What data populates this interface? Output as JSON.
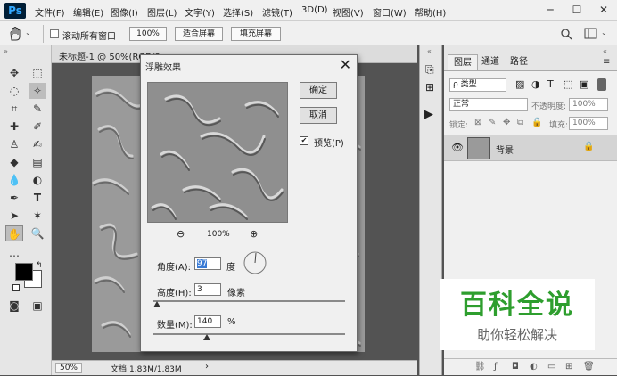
{
  "app": {
    "logo": "Ps"
  },
  "menubar": {
    "items": [
      "文件(F)",
      "编辑(E)",
      "图像(I)",
      "图层(L)",
      "文字(Y)",
      "选择(S)",
      "滤镜(T)",
      "3D(D)",
      "视图(V)",
      "窗口(W)",
      "帮助(H)"
    ],
    "window_controls": {
      "minimize": "─",
      "restore": "☐",
      "close": "✕"
    }
  },
  "options_bar": {
    "tool_icon": "hand-icon",
    "scroll_all_windows": {
      "label": "滚动所有窗口",
      "checked": false
    },
    "zoom_value": "100%",
    "fit_screen": "适合屏幕",
    "fill_screen": "填充屏幕"
  },
  "document": {
    "tab_title": "未标题-1 @ 50%(RGB/8...",
    "zoom": "50%",
    "doc_size": "文档:1.83M/1.83M"
  },
  "dialog": {
    "title": "浮雕效果",
    "close": "✕",
    "ok": "确定",
    "cancel": "取消",
    "preview": {
      "label": "预览(P)",
      "checked": true
    },
    "preview_zoom": "100%",
    "angle": {
      "label": "角度(A):",
      "value": "97",
      "unit": "度"
    },
    "height": {
      "label": "高度(H):",
      "value": "3",
      "unit": "像素",
      "slider_fraction": 0.02
    },
    "amount": {
      "label": "数量(M):",
      "value": "140",
      "unit": "%",
      "slider_fraction": 0.28
    }
  },
  "layers_panel": {
    "tabs": [
      "图层",
      "通道",
      "路径"
    ],
    "filter_kind": "ρ 类型",
    "blend_mode": "正常",
    "opacity_label": "不透明度:",
    "opacity_value": "100%",
    "lock_label": "锁定:",
    "fill_label": "填充:",
    "fill_value": "100%",
    "layers": [
      {
        "name": "背景",
        "visible": true,
        "locked": true
      }
    ]
  },
  "watermark": {
    "title": "百科全说",
    "subtitle": "助你轻松解决"
  }
}
